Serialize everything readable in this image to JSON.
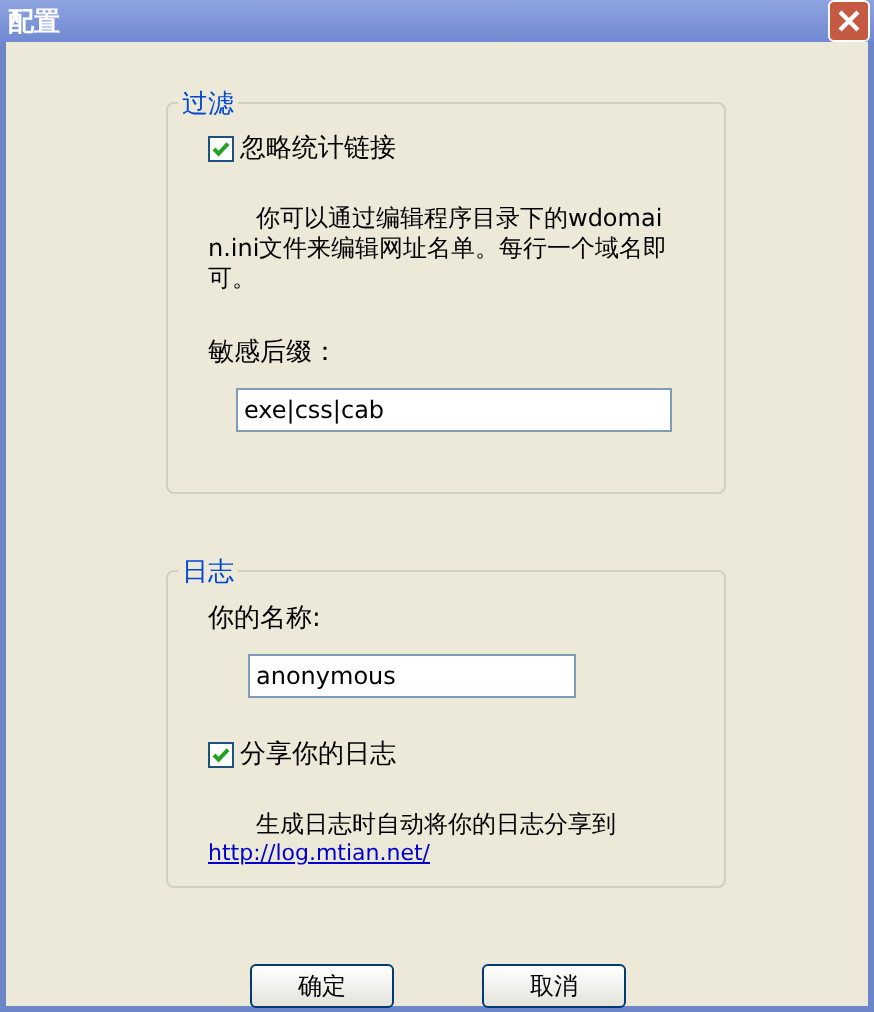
{
  "window": {
    "title": "配置"
  },
  "groups": [
    {
      "title": "过滤",
      "items": [
        {
          "kind": "checkbox",
          "label": "忽略统计链接",
          "checked": true
        },
        {
          "kind": "note",
          "text": "你可以通过编辑程序目录下的wdomain.ini文件来编辑网址名单。每行一个域名即可。"
        },
        {
          "kind": "label",
          "text": "敏感后缀："
        },
        {
          "kind": "field",
          "value": "exe|css|cab"
        }
      ]
    },
    {
      "title": "日志",
      "items": [
        {
          "kind": "label",
          "text": "你的名称:"
        },
        {
          "kind": "field",
          "value": "anonymous"
        },
        {
          "kind": "checkbox",
          "label": "分享你的日志",
          "checked": true
        },
        {
          "kind": "note",
          "text": "生成日志时自动将你的日志分享到"
        },
        {
          "kind": "link",
          "text": "http://log.mtian.net/"
        }
      ]
    }
  ],
  "buttons": [
    "确定",
    "取消"
  ]
}
